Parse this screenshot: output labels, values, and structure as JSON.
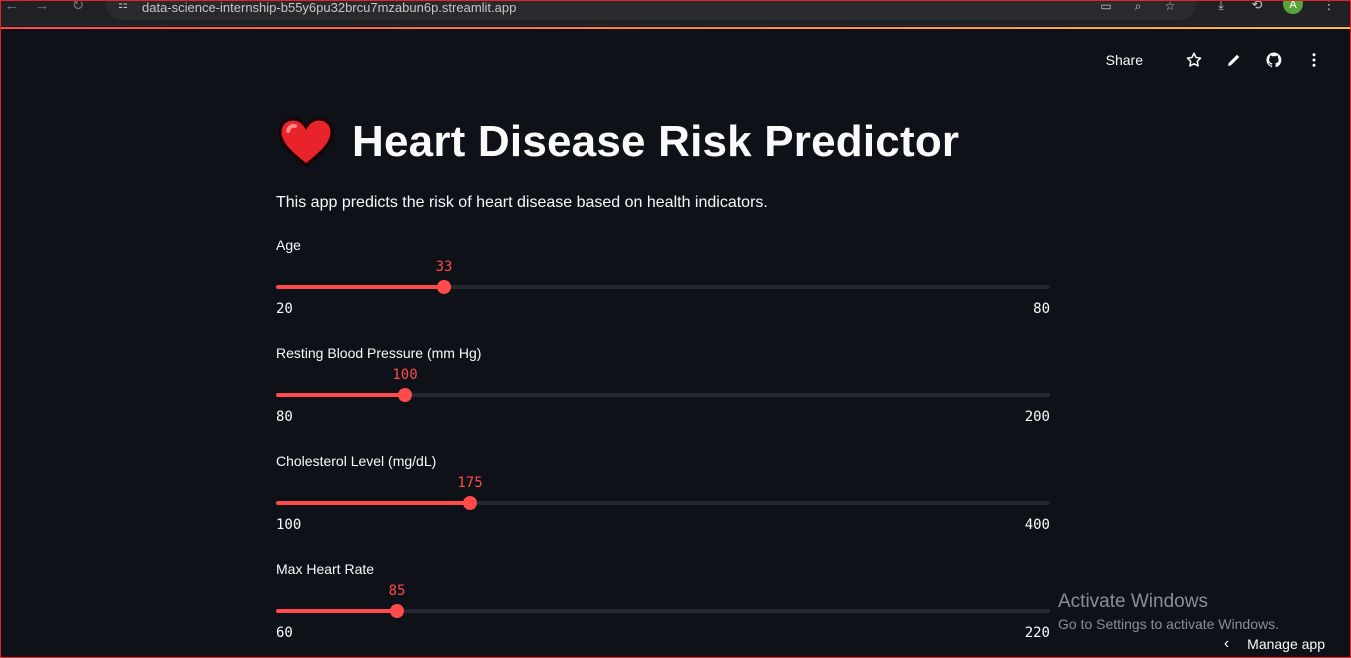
{
  "browser": {
    "url": "data-science-internship-b55y6pu32brcu7mzabun6p.streamlit.app",
    "avatar_letter": "A",
    "icons": [
      "back-icon",
      "forward-icon",
      "reload-icon",
      "site-settings-icon",
      "cast-icon",
      "zoom-icon",
      "bookmark-star-icon",
      "download-icon",
      "extensions-icon",
      "menu-dots-icon"
    ]
  },
  "toolbar": {
    "share_label": "Share",
    "icons": [
      "star-icon",
      "edit-pencil-icon",
      "github-icon",
      "more-vert-icon"
    ]
  },
  "app": {
    "title": "Heart Disease Risk Predictor",
    "title_icon": "red-heart-emoji",
    "description": "This app predicts the risk of heart disease based on health indicators."
  },
  "sliders": [
    {
      "label": "Age",
      "value": 33,
      "min": 20,
      "max": 80
    },
    {
      "label": "Resting Blood Pressure (mm Hg)",
      "value": 100,
      "min": 80,
      "max": 200
    },
    {
      "label": "Cholesterol Level (mg/dL)",
      "value": 175,
      "min": 100,
      "max": 400
    },
    {
      "label": "Max Heart Rate",
      "value": 85,
      "min": 60,
      "max": 220
    }
  ],
  "watermark": {
    "heading": "Activate Windows",
    "subtext": "Go to Settings to activate Windows."
  },
  "manage_app": {
    "label": "Manage app"
  },
  "colors": {
    "accent": "#ff4b4b",
    "background": "#0e1117",
    "track": "#262730"
  }
}
